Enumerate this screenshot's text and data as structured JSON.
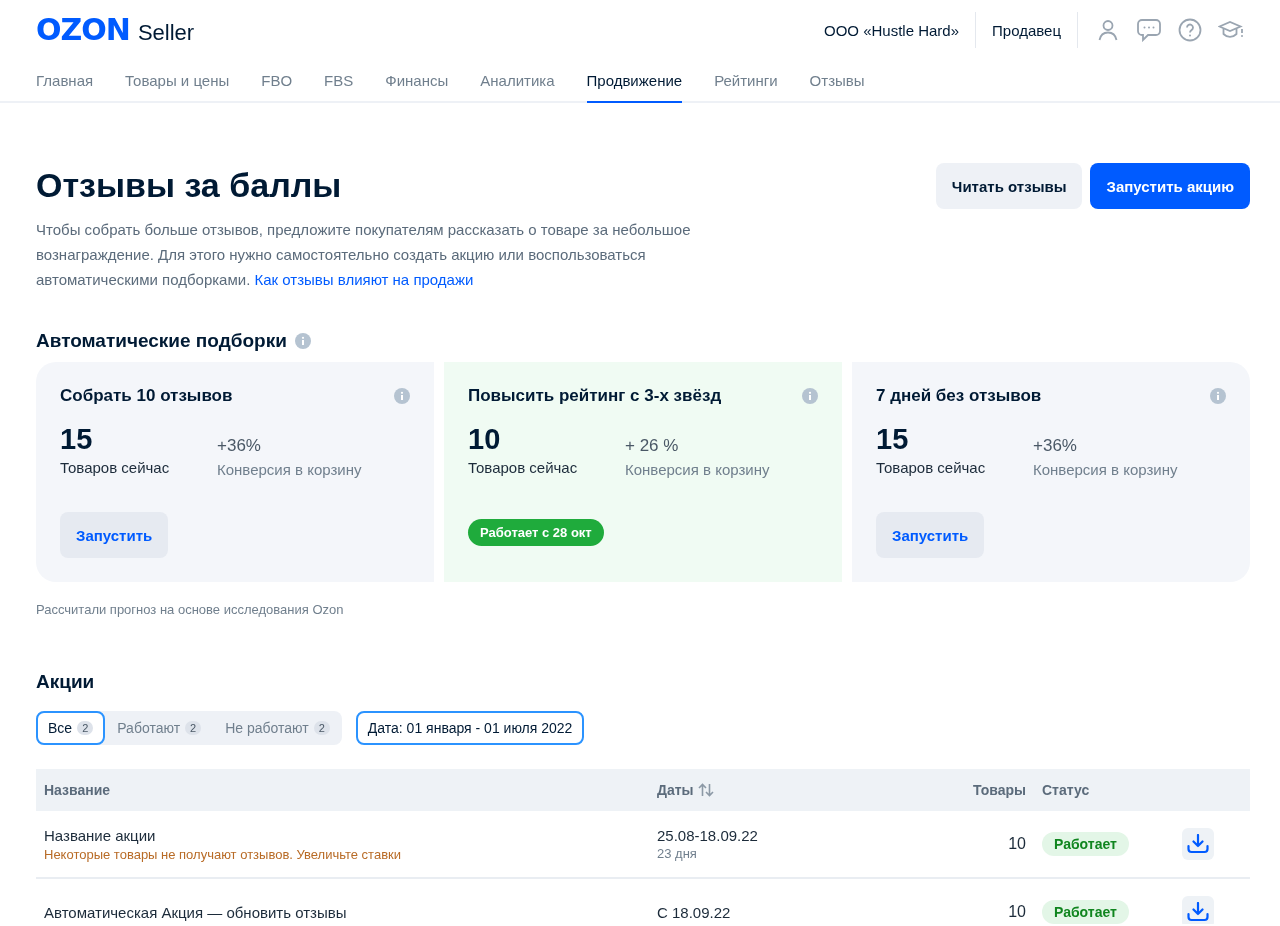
{
  "header": {
    "logo": "OZON",
    "logo_suffix": "Seller",
    "company": "ООО «Hustle Hard»",
    "role": "Продавец"
  },
  "nav": [
    {
      "label": "Главная",
      "selected": false
    },
    {
      "label": "Товары и цены",
      "selected": false
    },
    {
      "label": "FBO",
      "selected": false
    },
    {
      "label": "FBS",
      "selected": false
    },
    {
      "label": "Финансы",
      "selected": false
    },
    {
      "label": "Аналитика",
      "selected": false
    },
    {
      "label": "Продвижение",
      "selected": true
    },
    {
      "label": "Рейтинги",
      "selected": false
    },
    {
      "label": "Отзывы",
      "selected": false
    }
  ],
  "page": {
    "title": "Отзывы за баллы",
    "description": "Чтобы собрать больше отзывов, предложите покупателям рассказать о товаре за небольшое вознаграждение. Для этого нужно самостоятельно создать акцию или воспользоваться автоматическими подборками.",
    "link": "Как отзывы влияют на продажи",
    "buttons": [
      {
        "label": "Читать отзывы",
        "kind": "secondary"
      },
      {
        "label": "Запустить акцию",
        "kind": "primary"
      }
    ]
  },
  "auto": {
    "title": "Автоматические подборки",
    "cards": [
      {
        "title": "Собрать 10 отзывов",
        "count": "15",
        "count_label": "Товаров сейчас",
        "conversion": "+36%",
        "conversion_label": "Конверсия в корзину",
        "running": false,
        "action": "Запустить"
      },
      {
        "title": "Повысить рейтинг с 3-х звёзд",
        "count": "10",
        "count_label": "Товаров сейчас",
        "conversion": "+ 26 %",
        "conversion_label": "Конверсия в корзину",
        "running": true,
        "action": "Работает с 28 окт"
      },
      {
        "title": "7 дней без отзывов",
        "count": "15",
        "count_label": "Товаров сейчас",
        "conversion": "+36%",
        "conversion_label": "Конверсия в корзину",
        "running": false,
        "action": "Запустить"
      }
    ],
    "note": "Рассчитали прогноз на основе исследования Ozon"
  },
  "promos": {
    "title": "Акции",
    "filters": [
      {
        "label": "Все",
        "count": "2",
        "selected": true
      },
      {
        "label": "Работают",
        "count": "2",
        "selected": false
      },
      {
        "label": "Не работают",
        "count": "2",
        "selected": false
      }
    ],
    "date_filter": "Дата: 01 января - 01 июля 2022",
    "table": {
      "columns": [
        {
          "label": "Название",
          "sortable": false
        },
        {
          "label": "Даты",
          "sortable": true
        },
        {
          "label": "Товары",
          "sortable": false
        },
        {
          "label": "Статус",
          "sortable": false
        }
      ],
      "rows": [
        {
          "name": "Название акции",
          "warning": "Некоторые товары не получают отзывов. Увеличьте ставки",
          "dates": "25.08-18.09.22",
          "duration": "23 дня",
          "products": "10",
          "status": "Работает"
        },
        {
          "name": "Автоматическая Акция — обновить отзывы",
          "dates": "С 18.09.22",
          "products": "10",
          "status": "Работает"
        }
      ]
    }
  }
}
